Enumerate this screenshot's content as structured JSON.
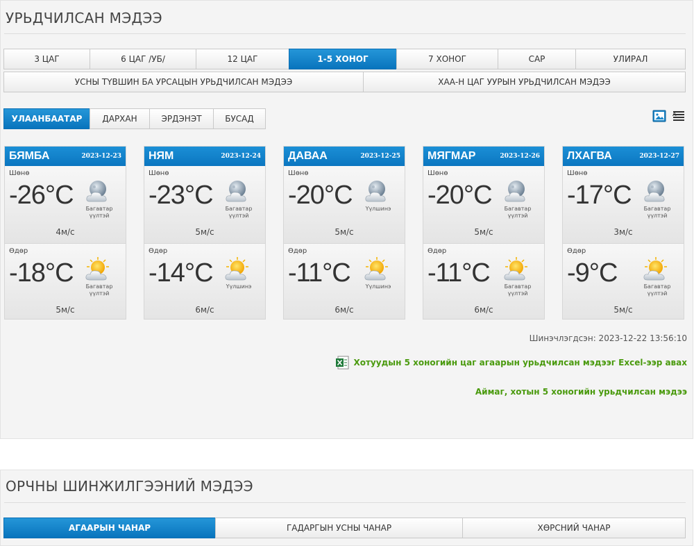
{
  "forecast_section": {
    "title": "УРЬДЧИЛСАН МЭДЭЭ",
    "range_tabs": [
      {
        "label": "3 ЦАГ",
        "active": false
      },
      {
        "label": "6 ЦАГ /УБ/",
        "active": false
      },
      {
        "label": "12 ЦАГ",
        "active": false
      },
      {
        "label": "1-5 ХОНОГ",
        "active": true
      },
      {
        "label": "7 ХОНОГ",
        "active": false
      },
      {
        "label": "САР",
        "active": false
      },
      {
        "label": "УЛИРАЛ",
        "active": false
      }
    ],
    "special_tabs": [
      {
        "label": "УСНЫ ТҮВШИН БА УРСАЦЫН УРЬДЧИЛСАН МЭДЭЭ"
      },
      {
        "label": "ХАА-Н ЦАГ УУРЫН УРЬДЧИЛСАН МЭДЭЭ"
      }
    ],
    "city_tabs": [
      {
        "label": "УЛААНБААТАР",
        "active": true
      },
      {
        "label": "ДАРХАН",
        "active": false
      },
      {
        "label": "ЭРДЭНЭТ",
        "active": false
      },
      {
        "label": "БУСАД",
        "active": false
      }
    ],
    "view_icons": [
      "image-view-icon",
      "list-view-icon"
    ],
    "days": [
      {
        "day": "БЯМБА",
        "date": "2023-12-23",
        "night": {
          "label": "Шөнө",
          "temp": "-26°C",
          "icon": "moon-cloud-icon",
          "condition": "Багавтар үүлтэй",
          "wind": "4м/с"
        },
        "day_part": {
          "label": "Өдөр",
          "temp": "-18°C",
          "icon": "sun-cloud-icon",
          "condition": "Багавтар үүлтэй",
          "wind": "5м/с"
        }
      },
      {
        "day": "НЯМ",
        "date": "2023-12-24",
        "night": {
          "label": "Шөнө",
          "temp": "-23°C",
          "icon": "moon-cloud-icon",
          "condition": "Багавтар үүлтэй",
          "wind": "5м/с"
        },
        "day_part": {
          "label": "Өдөр",
          "temp": "-14°C",
          "icon": "sun-cloud-icon",
          "condition": "Үүлшинэ",
          "wind": "6м/с"
        }
      },
      {
        "day": "ДАВАА",
        "date": "2023-12-25",
        "night": {
          "label": "Шөнө",
          "temp": "-20°C",
          "icon": "moon-cloud-icon",
          "condition": "Үүлшинэ",
          "wind": "5м/с"
        },
        "day_part": {
          "label": "Өдөр",
          "temp": "-11°C",
          "icon": "sun-cloud-icon",
          "condition": "Үүлшинэ",
          "wind": "6м/с"
        }
      },
      {
        "day": "МЯГМАР",
        "date": "2023-12-26",
        "night": {
          "label": "Шөнө",
          "temp": "-20°C",
          "icon": "moon-cloud-icon",
          "condition": "Багавтар үүлтэй",
          "wind": "5м/с"
        },
        "day_part": {
          "label": "Өдөр",
          "temp": "-11°C",
          "icon": "sun-cloud-icon",
          "condition": "Багавтар үүлтэй",
          "wind": "6м/с"
        }
      },
      {
        "day": "ЛХАГВА",
        "date": "2023-12-27",
        "night": {
          "label": "Шөнө",
          "temp": "-17°C",
          "icon": "moon-cloud-icon",
          "condition": "Багавтар үүлтэй",
          "wind": "3м/с"
        },
        "day_part": {
          "label": "Өдөр",
          "temp": "-9°C",
          "icon": "sun-cloud-icon",
          "condition": "Багавтар үүлтэй",
          "wind": "5м/с"
        }
      }
    ],
    "updated": "Шинэчлэгдсэн: 2023-12-22 13:56:10",
    "excel_link": "Хотуудын 5 хоногийн цаг агаарын урьдчилсан мэдээг Excel-ээр авах",
    "aimag_link": "Аймаг, хотын 5 хоногийн урьдчилсан мэдээ"
  },
  "env_section": {
    "title": "ОРЧНЫ ШИНЖИЛГЭЭНИЙ МЭДЭЭ",
    "tabs": [
      {
        "label": "АГААРЫН ЧАНАР",
        "active": true
      },
      {
        "label": "ГАДАРГЫН УСНЫ ЧАНАР",
        "active": false
      },
      {
        "label": "ХӨРСНИЙ ЧАНАР",
        "active": false
      }
    ]
  }
}
